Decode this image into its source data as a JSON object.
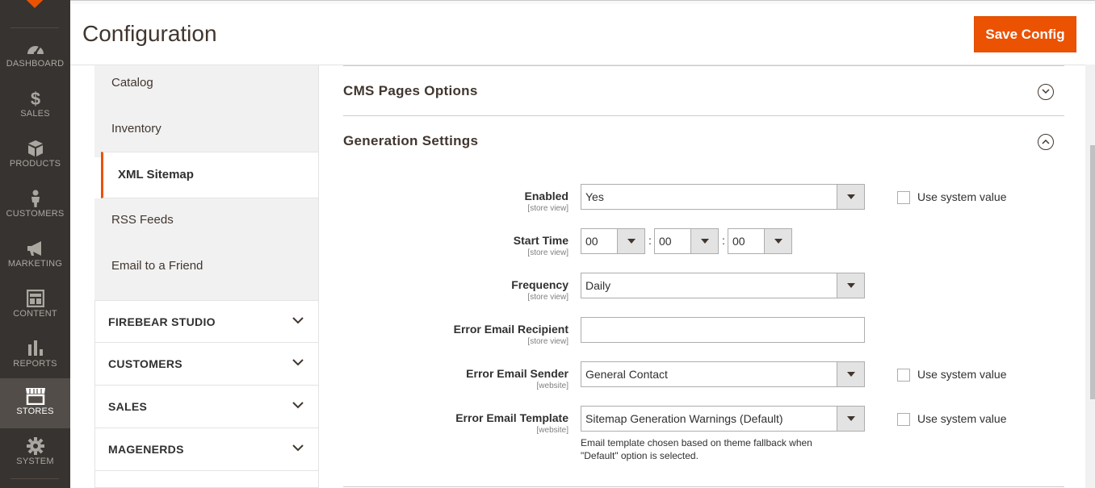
{
  "nav": {
    "items": [
      {
        "label": "DASHBOARD",
        "icon": "dashboard-icon"
      },
      {
        "label": "SALES",
        "icon": "dollar-icon"
      },
      {
        "label": "PRODUCTS",
        "icon": "box-icon"
      },
      {
        "label": "CUSTOMERS",
        "icon": "person-icon"
      },
      {
        "label": "MARKETING",
        "icon": "megaphone-icon"
      },
      {
        "label": "CONTENT",
        "icon": "layout-icon"
      },
      {
        "label": "REPORTS",
        "icon": "bar-chart-icon"
      },
      {
        "label": "STORES",
        "icon": "store-icon"
      },
      {
        "label": "SYSTEM",
        "icon": "gear-icon"
      }
    ],
    "active": "STORES"
  },
  "header": {
    "title": "Configuration",
    "save_label": "Save Config"
  },
  "sidebar": {
    "tabs": [
      "Catalog",
      "Inventory",
      "XML Sitemap",
      "RSS Feeds",
      "Email to a Friend"
    ],
    "active_tab": "XML Sitemap",
    "groups": [
      "FIREBEAR STUDIO",
      "CUSTOMERS",
      "SALES",
      "MAGENERDS"
    ]
  },
  "main": {
    "sections": {
      "cms": "CMS Pages Options",
      "generation": "Generation Settings"
    },
    "fields": {
      "enabled": {
        "label": "Enabled",
        "scope": "[store view]",
        "value": "Yes"
      },
      "start_time": {
        "label": "Start Time",
        "scope": "[store view]",
        "hour": "00",
        "minute": "00",
        "second": "00"
      },
      "frequency": {
        "label": "Frequency",
        "scope": "[store view]",
        "value": "Daily"
      },
      "error_recipient": {
        "label": "Error Email Recipient",
        "scope": "[store view]",
        "value": ""
      },
      "error_sender": {
        "label": "Error Email Sender",
        "scope": "[website]",
        "value": "General Contact"
      },
      "error_template": {
        "label": "Error Email Template",
        "scope": "[website]",
        "value": "Sitemap Generation Warnings (Default)"
      }
    },
    "use_system_value": "Use system value",
    "template_note": "Email template chosen based on theme fallback when \"Default\" option is selected.",
    "time_separator": ":"
  },
  "colors": {
    "accent": "#eb5202",
    "nav_bg": "#373330",
    "nav_active": "#524d49"
  }
}
